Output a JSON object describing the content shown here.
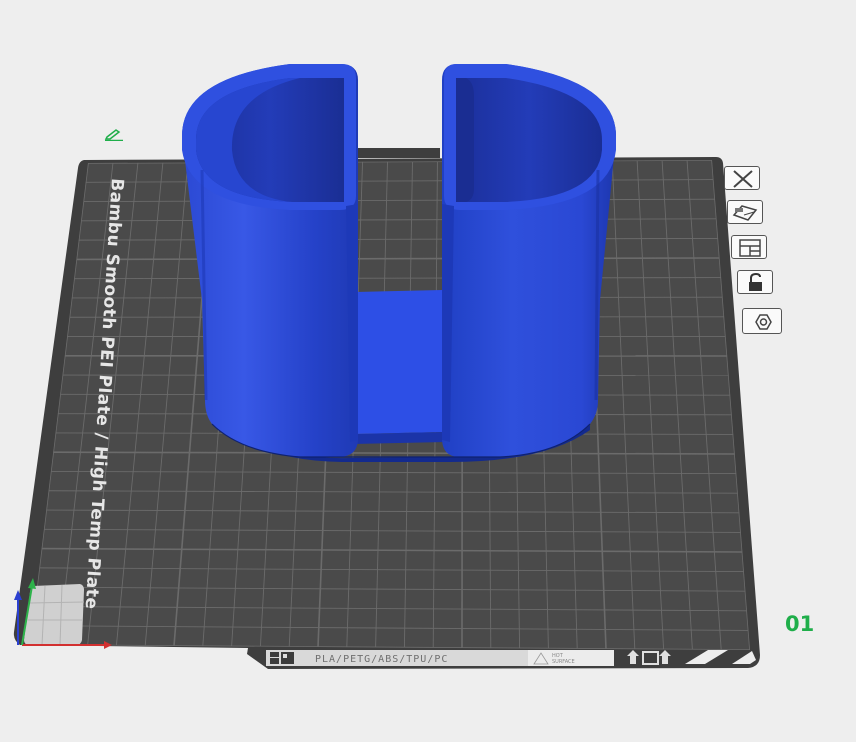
{
  "plate": {
    "name": "Bambu Smooth PEI Plate / High Temp Plate",
    "number": "01",
    "strip": {
      "filaments": "PLA/PETG/ABS/TPU/PC",
      "hot_surface_line1": "HOT",
      "hot_surface_line2": "SURFACE"
    }
  },
  "toolbar": {
    "icons": [
      "close-icon",
      "auto-orient-icon",
      "arrange-icon",
      "lock-icon",
      "settings-hex-icon"
    ]
  },
  "colors": {
    "model": "#2a4bdc",
    "plate": "#4a4a4a",
    "grid": "#6a6a6a",
    "plate_number": "#1fae4a",
    "axis_x": "#d23030",
    "axis_y": "#2db34a",
    "axis_z": "#2a3fd0"
  }
}
